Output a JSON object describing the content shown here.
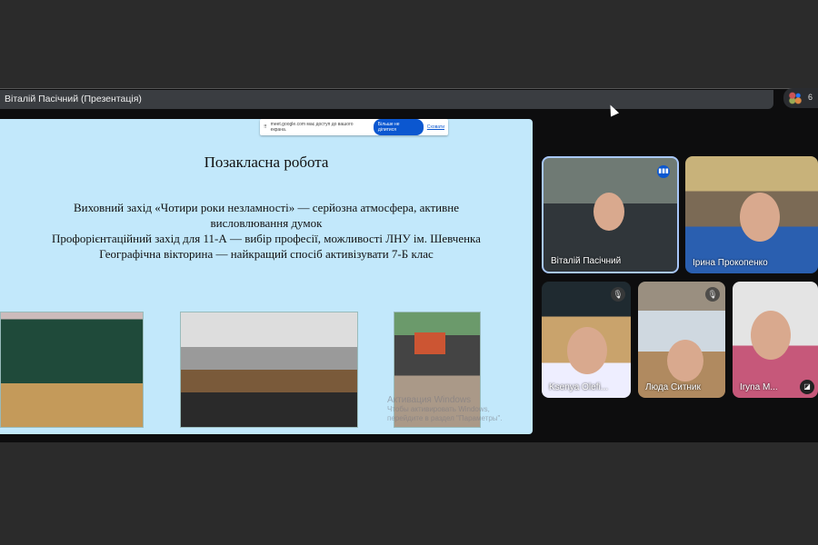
{
  "window": {
    "title": "Віталій Пасічний (Презентація)",
    "participant_count": "6"
  },
  "share_bar": {
    "message": "meet.google.com має доступ до вашого екрана.",
    "stop_button": "Більше не ділитися",
    "hide_link": "Сховати"
  },
  "slide": {
    "title": "Позакласна робота",
    "lines": [
      "Виховний захід «Чотири роки незламності» — серйозна атмосфера, активне висловлювання думок",
      "Профорієнтаційний захід для 11-А — вибір професії, можливості ЛНУ ім. Шевченка",
      "Географічна вікторина — найкращий спосіб активізувати 7-Б клас"
    ]
  },
  "watermark": {
    "title": "Активация Windows",
    "text": "Чтобы активировать Windows, перейдите в раздел \"Параметры\"."
  },
  "participants": [
    {
      "name": "Віталій Пасічний"
    },
    {
      "name": "Ірина Прокопенко"
    },
    {
      "name": "Ksenya Olefi..."
    },
    {
      "name": "Люда Ситник"
    },
    {
      "name": "Iryna M..."
    }
  ]
}
